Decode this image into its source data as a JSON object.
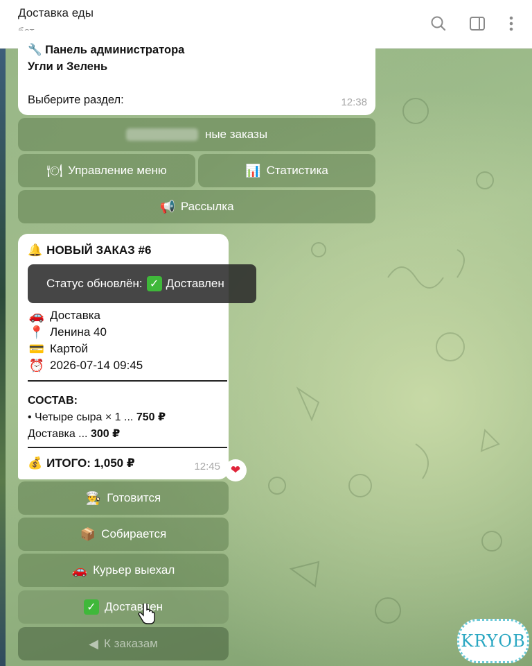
{
  "header": {
    "title": "Доставка еды",
    "subtitle": "бот",
    "icons": [
      "search-icon",
      "sidebar-toggle-icon",
      "more-vertical-icon"
    ]
  },
  "admin_message": {
    "line1": "Панель администратора",
    "line2": "Угли и Зелень",
    "line3": "Выберите раздел:",
    "time": "12:38",
    "buttons": {
      "orders": "ные заказы",
      "menu": "Управление меню",
      "stats": "Статистика",
      "broadcast": "Рассылка"
    }
  },
  "order_message": {
    "title": "НОВЫЙ ЗАКАЗ #6",
    "delivery_type": "Доставка",
    "address": "Ленина 40",
    "payment": "Картой",
    "datetime": "2026-07-14 09:45",
    "composition_label": "СОСТАВ:",
    "item_name": "• Четыре сыра × 1 ...",
    "item_price": "750 ₽",
    "delivery_name": "Доставка ...",
    "delivery_price": "300 ₽",
    "total": "ИТОГО: 1,050 ₽",
    "time": "12:45",
    "reaction": "❤"
  },
  "toast": {
    "prefix": "Статус обновлён:",
    "status": "Доставлен"
  },
  "status_buttons": {
    "cooking": "Готовится",
    "packing": "Собирается",
    "courier": "Курьер выехал",
    "delivered": "Доставлен",
    "back": "К заказам"
  },
  "watermark": "KRYOB",
  "colors": {
    "accent_green": "#3fb83a",
    "heart_red": "#e0243a",
    "keyboard_bg": "#608050"
  }
}
